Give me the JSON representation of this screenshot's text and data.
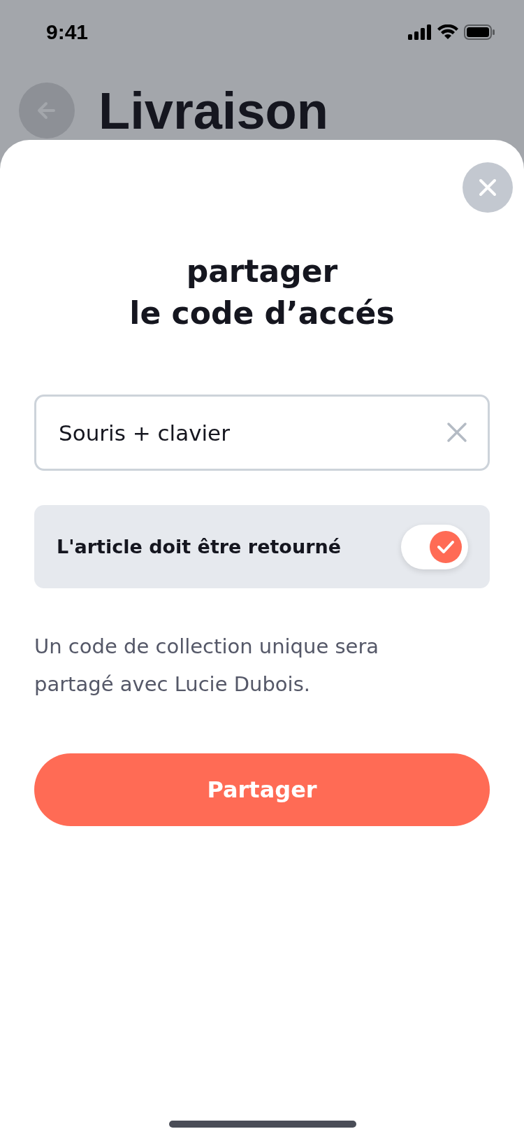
{
  "status_bar": {
    "time": "9:41"
  },
  "header": {
    "title": "Livraison"
  },
  "sheet": {
    "title": "partager\nle code d’accés",
    "field": {
      "value": "Souris + clavier"
    },
    "option": {
      "label": "L'article doit être retourné",
      "on": true
    },
    "description": "Un code de collection unique sera partagé avec Lucie Dubois.",
    "button": {
      "label": "Partager"
    }
  }
}
